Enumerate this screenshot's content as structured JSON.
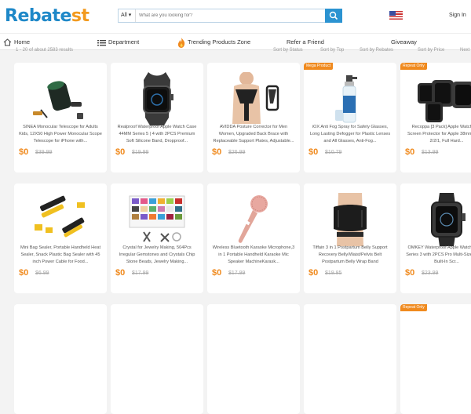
{
  "header": {
    "logo_part1": "Rebate",
    "logo_part2": "st",
    "search": {
      "category": "All",
      "placeholder": "What are you looking for?"
    },
    "language_flag": "us-flag-icon",
    "signin": "Sign In"
  },
  "nav": {
    "home": "Home",
    "department": "Department",
    "trending": "Trending Products Zone",
    "refer": "Refer a Friend",
    "giveaway": "Giveaway"
  },
  "sortbar": {
    "results": "1 - 20 of about 2583 results",
    "sort_status": "Sort by Status",
    "sort_top": "Sort by Top",
    "sort_rebates": "Sort by Rebates",
    "sort_price": "Sort by Price",
    "next": "Next"
  },
  "colors": {
    "brand_blue": "#1e88c8",
    "brand_orange": "#f29a1f",
    "price": "#f08a1e",
    "search_button": "#2b93d1"
  },
  "products": [
    {
      "title": "SINEA Monocular Telescope for Adults Kids, 12X50 High Power Monocular Scope Telescope for iPhone with...",
      "price": "$0",
      "original": "$39.99",
      "badge": "",
      "icon": "telescope-icon"
    },
    {
      "title": "Realproof Waterproof Apple Watch Case 44MM Series 5 | 4 with 2PCS Premium Soft Silicone Band, Dropproof...",
      "price": "$0",
      "original": "$19.99",
      "badge": "",
      "icon": "watch-icon"
    },
    {
      "title": "AVIDDA Posture Corrector for Men Women, Upgraded Back Brace with Replaceable Support Plates, Adjustable...",
      "price": "$0",
      "original": "$26.99",
      "badge": "",
      "icon": "posture-brace-icon"
    },
    {
      "title": "iOX Anti Fog Spray for Safety Glasses, Long Lasting Defogger for Plastic Lenses and All Glasses, Anti-Fog...",
      "price": "$0",
      "original": "$10.79",
      "badge": "Mega Product",
      "icon": "spray-bottle-icon"
    },
    {
      "title": "Recoppa [3 Pack] Apple Watch with Screen Protector for Apple 38mm Series 2/2/1, Full Hard...",
      "price": "$0",
      "original": "$13.99",
      "badge": "Repeat Only",
      "icon": "watch-cases-icon"
    },
    {
      "title": "Mini Bag Sealer, Portable Handheld Heat Sealer, Snack Plastic Bag Sealer with 45 inch Power Cable for Food...",
      "price": "$0",
      "original": "$6.99",
      "badge": "",
      "icon": "bag-sealer-icon"
    },
    {
      "title": "Crystal for Jewelry Making, 504Pcs Irregular Gemstones and Crystals Chip Stone Beads, Jewelry Making...",
      "price": "$0",
      "original": "$17.99",
      "badge": "",
      "icon": "beads-kit-icon"
    },
    {
      "title": "Wireless Bluetooth Karaoke Microphone,3 in 1 Portable Handheld Karaoke Mic Speaker MachineKarask...",
      "price": "$0",
      "original": "$17.99",
      "badge": "",
      "icon": "microphone-icon"
    },
    {
      "title": "Tiffain 3 in 1 Postpartum Belly Support Recovery Belly/Waist/Pelvis Belt Postpartum Belly Wrap Band",
      "price": "$0",
      "original": "$19.85",
      "badge": "",
      "icon": "belly-band-icon"
    },
    {
      "title": "OMKEY Waterproof Apple Watch 42mm Series 3 with 2PCS Pro Multi-Size Bands, Built-In Scr...",
      "price": "$0",
      "original": "$23.99",
      "badge": "",
      "icon": "rugged-watch-icon"
    }
  ],
  "row3_badge": "Repeat Only"
}
